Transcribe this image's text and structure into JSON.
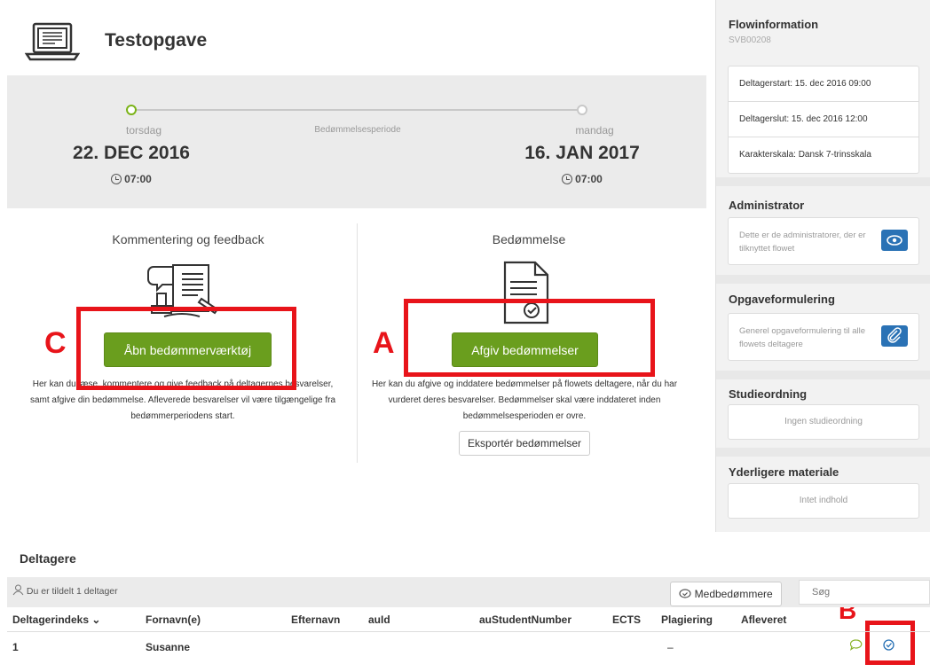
{
  "header": {
    "title": "Testopgave"
  },
  "period": {
    "label": "Bedømmelsesperiode",
    "start": {
      "day": "torsdag",
      "date": "22. DEC 2016",
      "time": "07:00"
    },
    "end": {
      "day": "mandag",
      "date": "16. JAN 2017",
      "time": "07:00"
    }
  },
  "feedback_panel": {
    "title": "Kommentering og feedback",
    "button": "Åbn bedømmerværktøj",
    "desc": [
      "Her kan du læse, kommentere og give feedback på deltagernes besvarelser,",
      "samt afgive din bedømmelse. Afleverede besvarelser vil være tilgængelige fra",
      "bedømmerperiodens start."
    ]
  },
  "grading_panel": {
    "title": "Bedømmelse",
    "button": "Afgiv bedømmelser",
    "desc": [
      "Her kan du afgive og inddatere bedømmelser på flowets deltagere, når du har",
      "vurderet deres besvarelser. Bedømmelser skal være inddateret inden",
      "bedømmelsesperioden er ovre."
    ],
    "export_button": "Eksportér bedømmelser"
  },
  "annotations": {
    "a": "A",
    "b": "B",
    "c": "C"
  },
  "sidebar": {
    "flow_title": "Flowinformation",
    "flow_id": "SVB00208",
    "flow_rows": [
      "Deltagerstart: 15. dec 2016 09:00",
      "Deltagerslut: 15. dec 2016 12:00",
      "Karakterskala: Dansk 7-trinsskala"
    ],
    "admin_title": "Administrator",
    "admin_text": "Dette er de administratorer, der er tilknyttet flowet",
    "task_title": "Opgaveformulering",
    "task_text": "Generel opgaveformulering til alle flowets deltagere",
    "study_title": "Studieordning",
    "study_empty": "Ingen studieordning",
    "material_title": "Yderligere materiale",
    "material_empty": "Intet indhold"
  },
  "participants": {
    "title": "Deltagere",
    "assigned": "Du er tildelt 1 deltager",
    "co_graders_button": "Medbedømmere",
    "search_placeholder": "Søg",
    "columns": [
      "Deltagerindeks",
      "Fornavn(e)",
      "Efternavn",
      "auId",
      "auStudentNumber",
      "ECTS",
      "Plagiering",
      "Afleveret"
    ],
    "row": {
      "index": "1",
      "first_name": "Susanne",
      "plagiarism": "–"
    }
  },
  "colors": {
    "accent_green": "#6a9e1e",
    "accent_blue": "#2a72b5",
    "annotation_red": "#e8141a"
  }
}
